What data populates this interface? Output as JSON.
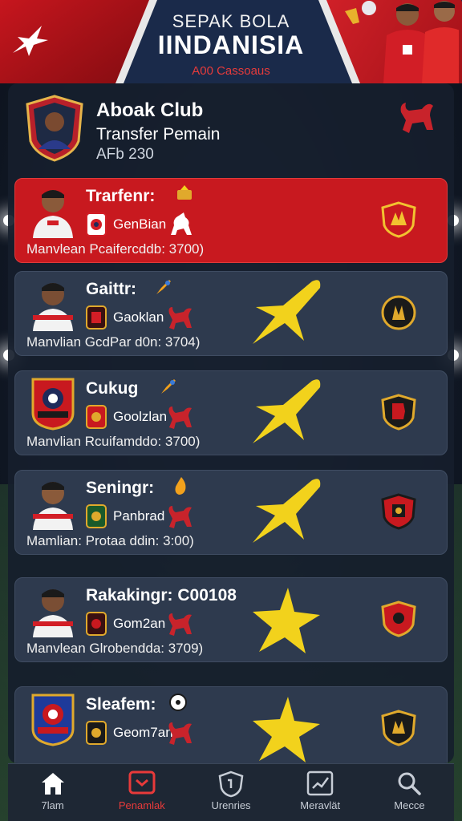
{
  "header": {
    "title_top": "SEPAK BOLA",
    "title_main": "IINDANISIA",
    "subtitle": "A00 Cassoaus"
  },
  "club": {
    "name": "Aboak Club",
    "subtitle": "Transfer Pemain",
    "date": "AFb 230"
  },
  "transfers": [
    {
      "name": "Trarfenr:",
      "club": "GenBian",
      "value": "Manvlean Pcaifercddb: 3700)",
      "active": true
    },
    {
      "name": "Gaittr:",
      "club": "Gaoklan",
      "value": "Manvlian GcdPar d0n: 3704)",
      "active": false
    },
    {
      "name": "Cukug",
      "club": "Goolzlan",
      "value": "Manvlian Rcuifamddo: 3700)",
      "active": false
    },
    {
      "name": "Seningr:",
      "club": "Panbrad",
      "value": "Mamlian: Protaa ddin: 3:00)",
      "active": false
    },
    {
      "name": "Rakakingr: C00108",
      "club": "Gom2an",
      "value": "Manvlean Glrobendda: 3709)",
      "active": false
    },
    {
      "name": "Sleafem:",
      "club": "Geom7an",
      "value": "",
      "active": false
    }
  ],
  "nav": {
    "items": [
      {
        "label": "7lam",
        "icon": "home-icon"
      },
      {
        "label": "Penamlak",
        "icon": "transfer-icon"
      },
      {
        "label": "Urenries",
        "icon": "shield-icon"
      },
      {
        "label": "Meravlät",
        "icon": "chart-icon"
      },
      {
        "label": "Mecce",
        "icon": "search-icon"
      }
    ],
    "active_index": 1
  },
  "colors": {
    "accent_red": "#c8191f",
    "card_bg": "#2e3a4e",
    "star_yellow": "#f2d21c",
    "panel_bg": "#161e2c"
  }
}
